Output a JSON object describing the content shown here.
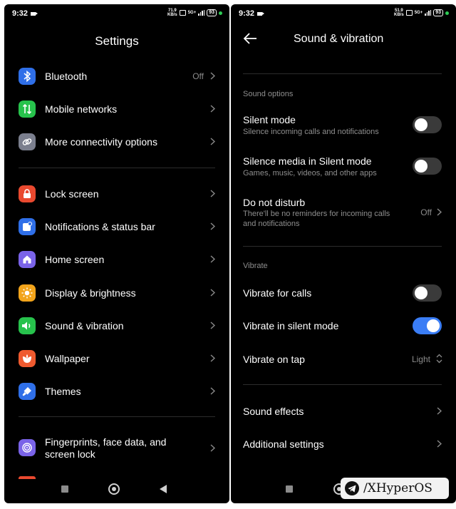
{
  "left": {
    "status": {
      "time": "9:32",
      "speed_top": "71.9",
      "speed_bottom": "KB/s",
      "net": "5G+",
      "battery": "93"
    },
    "title": "Settings",
    "group1": [
      {
        "label": "Bluetooth",
        "value": "Off",
        "icon": "bluetooth-icon",
        "color": "#2f6fe8"
      },
      {
        "label": "Mobile networks",
        "icon": "mobile-data-icon",
        "color": "#27c24c"
      },
      {
        "label": "More connectivity options",
        "icon": "link-icon",
        "color": "#7b7f8e"
      }
    ],
    "group2": [
      {
        "label": "Lock screen",
        "icon": "lock-icon",
        "color": "#e9492f"
      },
      {
        "label": "Notifications & status bar",
        "icon": "notification-icon",
        "color": "#2f6fe8"
      },
      {
        "label": "Home screen",
        "icon": "home-icon",
        "color": "#7a63e8"
      },
      {
        "label": "Display & brightness",
        "icon": "sun-icon",
        "color": "#f2a41b"
      },
      {
        "label": "Sound & vibration",
        "icon": "speaker-icon",
        "color": "#27c24c"
      },
      {
        "label": "Wallpaper",
        "icon": "flower-icon",
        "color": "#ef5a2f"
      },
      {
        "label": "Themes",
        "icon": "brush-icon",
        "color": "#2f6fe8"
      }
    ],
    "group3": [
      {
        "label_line1": "Fingerprints, face data, and",
        "label_line2": "screen lock",
        "icon": "fingerprint-icon",
        "color": "#7a63e8"
      }
    ]
  },
  "right": {
    "status": {
      "time": "9:32",
      "speed_top": "51.9",
      "speed_bottom": "KB/s",
      "net": "5G+",
      "battery": "93"
    },
    "title": "Sound & vibration",
    "sound_options_header": "Sound options",
    "silent_mode": {
      "label": "Silent mode",
      "sub": "Silence incoming calls and notifications",
      "on": false
    },
    "silence_media": {
      "label": "Silence media in Silent mode",
      "sub": "Games, music, videos, and other apps",
      "on": false
    },
    "dnd": {
      "label": "Do not disturb",
      "sub": "There'll be no reminders for incoming calls and notifications",
      "value": "Off"
    },
    "vibrate_header": "Vibrate",
    "vibrate_calls": {
      "label": "Vibrate for calls",
      "on": false
    },
    "vibrate_silent": {
      "label": "Vibrate in silent mode",
      "on": true
    },
    "vibrate_tap": {
      "label": "Vibrate on tap",
      "value": "Light"
    },
    "sound_effects": "Sound effects",
    "additional_settings": "Additional settings"
  },
  "watermark": "/XHyperOS"
}
